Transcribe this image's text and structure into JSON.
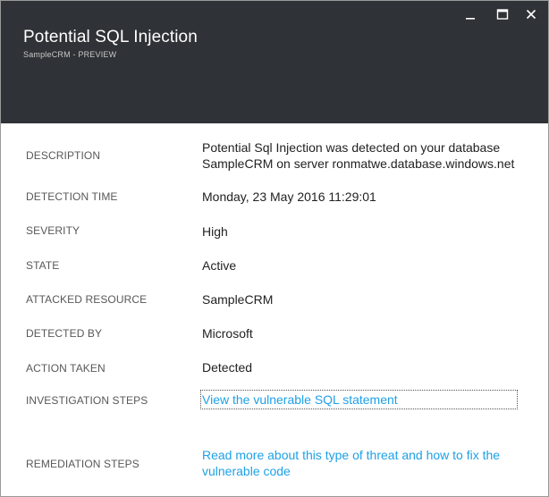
{
  "header": {
    "title": "Potential SQL Injection",
    "subtitle": "SampleCRM - PREVIEW",
    "window_buttons": [
      "minimize-icon",
      "maximize-icon",
      "close-icon"
    ]
  },
  "fields": {
    "description": {
      "label": "DESCRIPTION",
      "line1": "Potential Sql Injection was detected on your database",
      "line2": "SampleCRM on server ronmatwe.database.windows.net"
    },
    "detection_time": {
      "label": "DETECTION TIME",
      "value": "Monday, 23 May 2016 11:29:01"
    },
    "severity": {
      "label": "SEVERITY",
      "value": "High"
    },
    "state": {
      "label": "STATE",
      "value": "Active"
    },
    "attacked_resource": {
      "label": "ATTACKED RESOURCE",
      "value": "SampleCRM"
    },
    "detected_by": {
      "label": "DETECTED BY",
      "value": "Microsoft"
    },
    "action_taken": {
      "label": "ACTION TAKEN",
      "value": "Detected"
    },
    "investigation_steps": {
      "label": "INVESTIGATION STEPS",
      "link": "View the vulnerable SQL statement"
    },
    "remediation_steps": {
      "label": "REMEDIATION STEPS",
      "link_line1": "Read more about this type of threat and how to fix the",
      "link_line2": "vulnerable code"
    }
  },
  "colors": {
    "header_bg": "#2f3236",
    "link": "#1ea1e6",
    "label": "#585858",
    "value": "#222222"
  }
}
